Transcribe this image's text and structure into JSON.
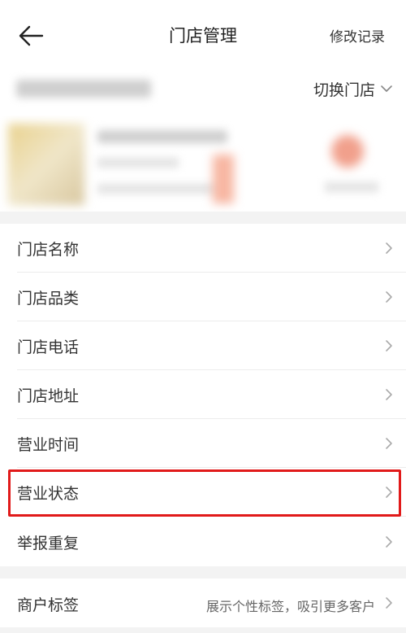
{
  "header": {
    "title": "门店管理",
    "history_label": "修改记录"
  },
  "store_bar": {
    "switch_label": "切换门店"
  },
  "menu": {
    "items": [
      {
        "label": "门店名称"
      },
      {
        "label": "门店品类"
      },
      {
        "label": "门店电话"
      },
      {
        "label": "门店地址"
      },
      {
        "label": "营业时间"
      },
      {
        "label": "营业状态"
      },
      {
        "label": "举报重复"
      }
    ]
  },
  "merchant_tag": {
    "label": "商户标签",
    "description": "展示个性标签，吸引更多客户"
  },
  "colors": {
    "highlight": "#e11a1a",
    "background": "#f3f3f3"
  }
}
